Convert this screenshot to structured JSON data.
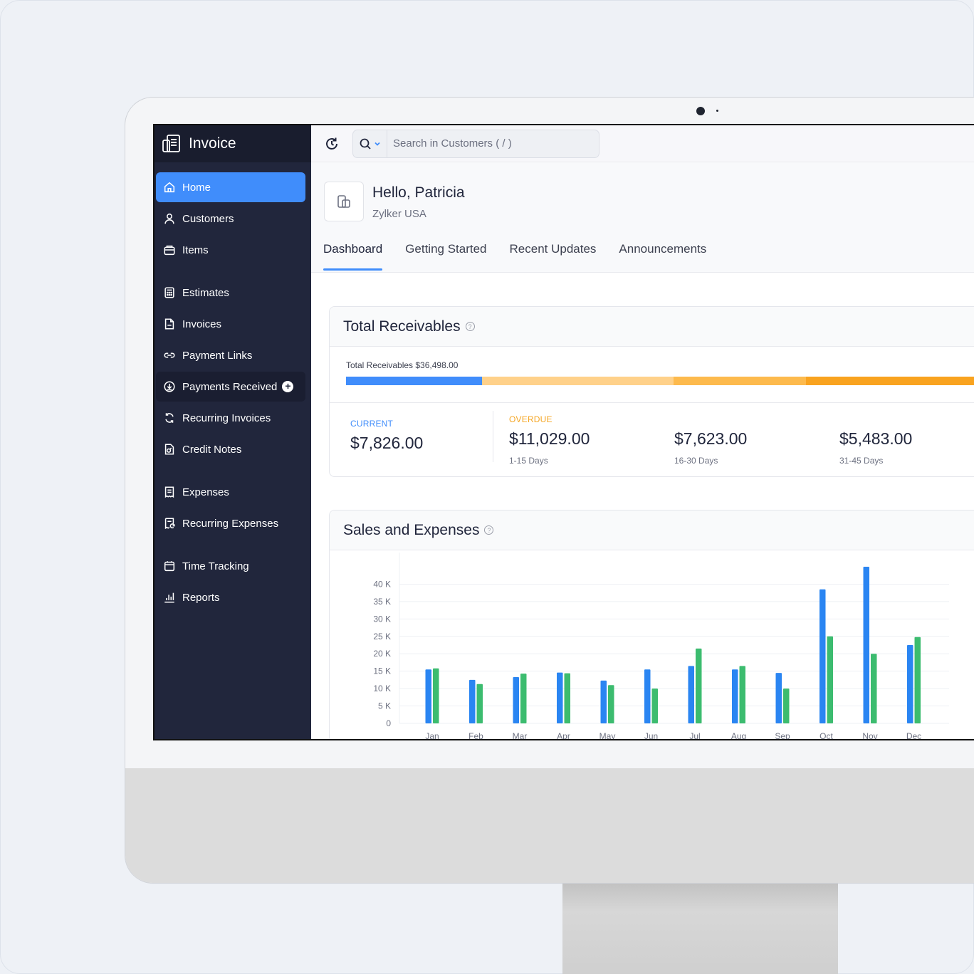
{
  "app": {
    "name": "Invoice"
  },
  "sidebar": {
    "items": [
      {
        "label": "Home",
        "icon": "home-icon"
      },
      {
        "label": "Customers",
        "icon": "user-icon"
      },
      {
        "label": "Items",
        "icon": "box-icon"
      },
      {
        "label": "Estimates",
        "icon": "calculator-icon"
      },
      {
        "label": "Invoices",
        "icon": "document-icon"
      },
      {
        "label": "Payment Links",
        "icon": "link-icon"
      },
      {
        "label": "Payments Received",
        "icon": "download-icon"
      },
      {
        "label": "Recurring Invoices",
        "icon": "recurring-icon"
      },
      {
        "label": "Credit Notes",
        "icon": "credit-note-icon"
      },
      {
        "label": "Expenses",
        "icon": "receipt-icon"
      },
      {
        "label": "Recurring Expenses",
        "icon": "recurring-receipt-icon"
      },
      {
        "label": "Time Tracking",
        "icon": "calendar-icon"
      },
      {
        "label": "Reports",
        "icon": "bar-chart-icon"
      }
    ]
  },
  "search": {
    "placeholder": "Search in Customers ( / )"
  },
  "header": {
    "greeting": "Hello, Patricia",
    "org_name": "Zylker USA",
    "tabs": [
      "Dashboard",
      "Getting Started",
      "Recent Updates",
      "Announcements"
    ]
  },
  "receivables": {
    "title": "Total Receivables",
    "help_glyph": "?",
    "total_label": "Total Receivables $36,498.00",
    "colors": {
      "current": "#408dfb",
      "overdue_1": "#ffd18a",
      "overdue_2": "#fdba4d",
      "overdue_3": "#f9a31f"
    },
    "bar_fractions": [
      0.214,
      0.302,
      0.209,
      0.275
    ],
    "current": {
      "caption": "CURRENT",
      "amount": "$7,826.00"
    },
    "overdue_caption": "OVERDUE",
    "overdue": [
      {
        "amount": "$11,029.00",
        "range": "1-15 Days"
      },
      {
        "amount": "$7,623.00",
        "range": "16-30 Days"
      },
      {
        "amount": "$5,483.00",
        "range": "31-45 Days"
      }
    ]
  },
  "sales": {
    "title": "Sales and Expenses",
    "help_glyph": "?"
  },
  "chart_data": {
    "type": "bar",
    "categories": [
      "Jan",
      "Feb",
      "Mar",
      "Apr",
      "May",
      "Jun",
      "Jul",
      "Aug",
      "Sep",
      "Oct",
      "Nov",
      "Dec"
    ],
    "series": [
      {
        "color": "#2a85f2",
        "values": [
          15500,
          12500,
          13300,
          14600,
          12300,
          15500,
          16500,
          15500,
          14500,
          38500,
          45000,
          22500
        ]
      },
      {
        "color": "#3cbc6f",
        "values": [
          15800,
          11300,
          14300,
          14400,
          11000,
          10000,
          21500,
          16500,
          10000,
          25000,
          20000,
          24800
        ]
      }
    ],
    "yticks": [
      "0",
      "5 K",
      "10 K",
      "15 K",
      "20 K",
      "25 K",
      "30 K",
      "35 K",
      "40 K"
    ],
    "ylim": [
      0,
      45000
    ],
    "grid": true
  }
}
